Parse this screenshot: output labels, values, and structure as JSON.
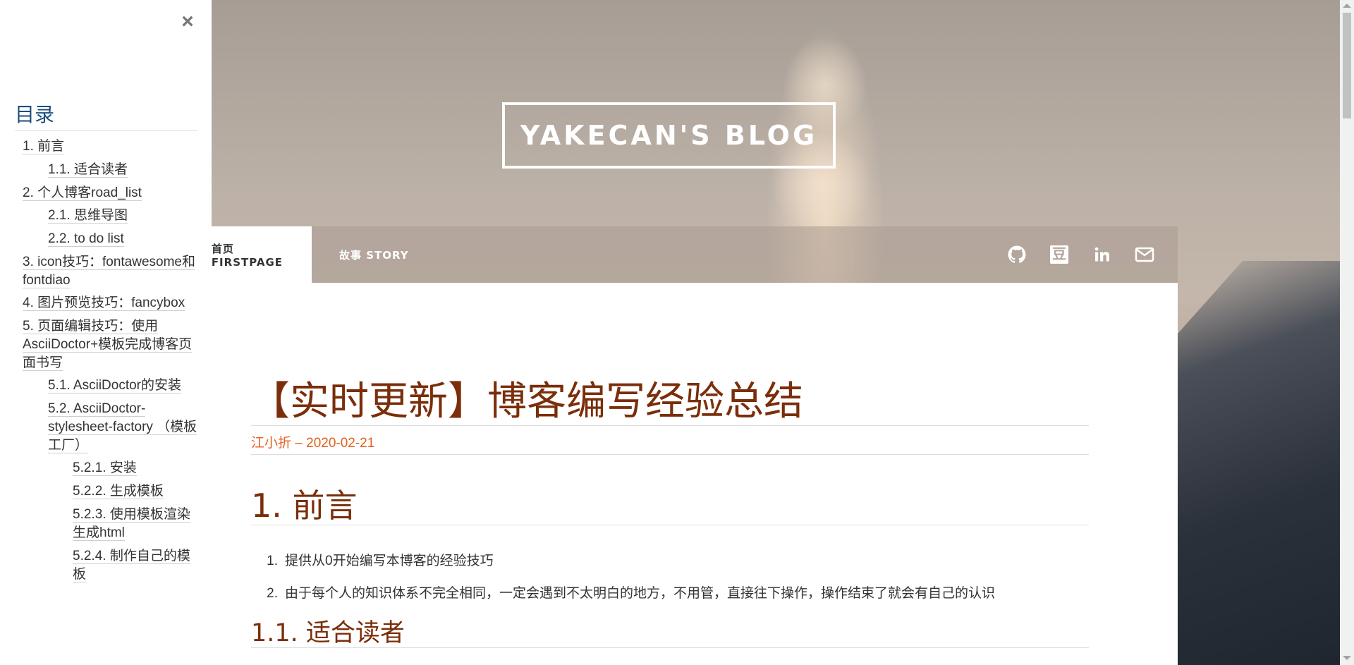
{
  "header": {
    "site_title": "YAKECAN'S BLOG"
  },
  "nav": {
    "items": [
      {
        "label": "首页 FIRSTPAGE",
        "active": true
      },
      {
        "label": "故事 STORY",
        "active": false
      }
    ],
    "social_icons": [
      "github-icon",
      "douban-icon",
      "linkedin-icon",
      "mail-icon"
    ],
    "douban_glyph": "豆"
  },
  "post": {
    "title": "【实时更新】博客编写经验总结",
    "meta": "江小折 – 2020-02-21",
    "section_1": "1. 前言",
    "list": [
      {
        "num": "1.",
        "text": "提供从0开始编写本博客的经验技巧"
      },
      {
        "num": "2.",
        "text": "由于每个人的知识体系不完全相同，一定会遇到不太明白的地方，不用管，直接往下操作，操作结束了就会有自己的认识"
      }
    ],
    "section_1_1": "1.1. 适合读者"
  },
  "toc": {
    "close_symbol": "×",
    "title": "目录",
    "items": [
      {
        "label": "1. 前言"
      },
      {
        "label": "1.1. 适合读者"
      },
      {
        "label": "2. 个人博客road_list"
      },
      {
        "label": "2.1. 思维导图"
      },
      {
        "label": "2.2. to do list"
      },
      {
        "label": "3. icon技巧：fontawesome和fontdiao"
      },
      {
        "label": "4. 图片预览技巧：fancybox"
      },
      {
        "label": "5. 页面编辑技巧：使用AsciiDoctor+模板完成博客页面书写"
      },
      {
        "label": "5.1. AsciiDoctor的安装"
      },
      {
        "label": "5.2. AsciiDoctor-stylesheet-factory （模板工厂）"
      },
      {
        "label": "5.2.1. 安装"
      },
      {
        "label": "5.2.2. 生成模板"
      },
      {
        "label": "5.2.3. 使用模板渲染生成html"
      },
      {
        "label": "5.2.4. 制作自己的模板"
      }
    ]
  },
  "colors": {
    "heading": "#7a2e0a",
    "meta": "#e4601e",
    "toc_title": "#1d4d7c",
    "nav_bg": "rgba(170,155,145,0.55)"
  }
}
